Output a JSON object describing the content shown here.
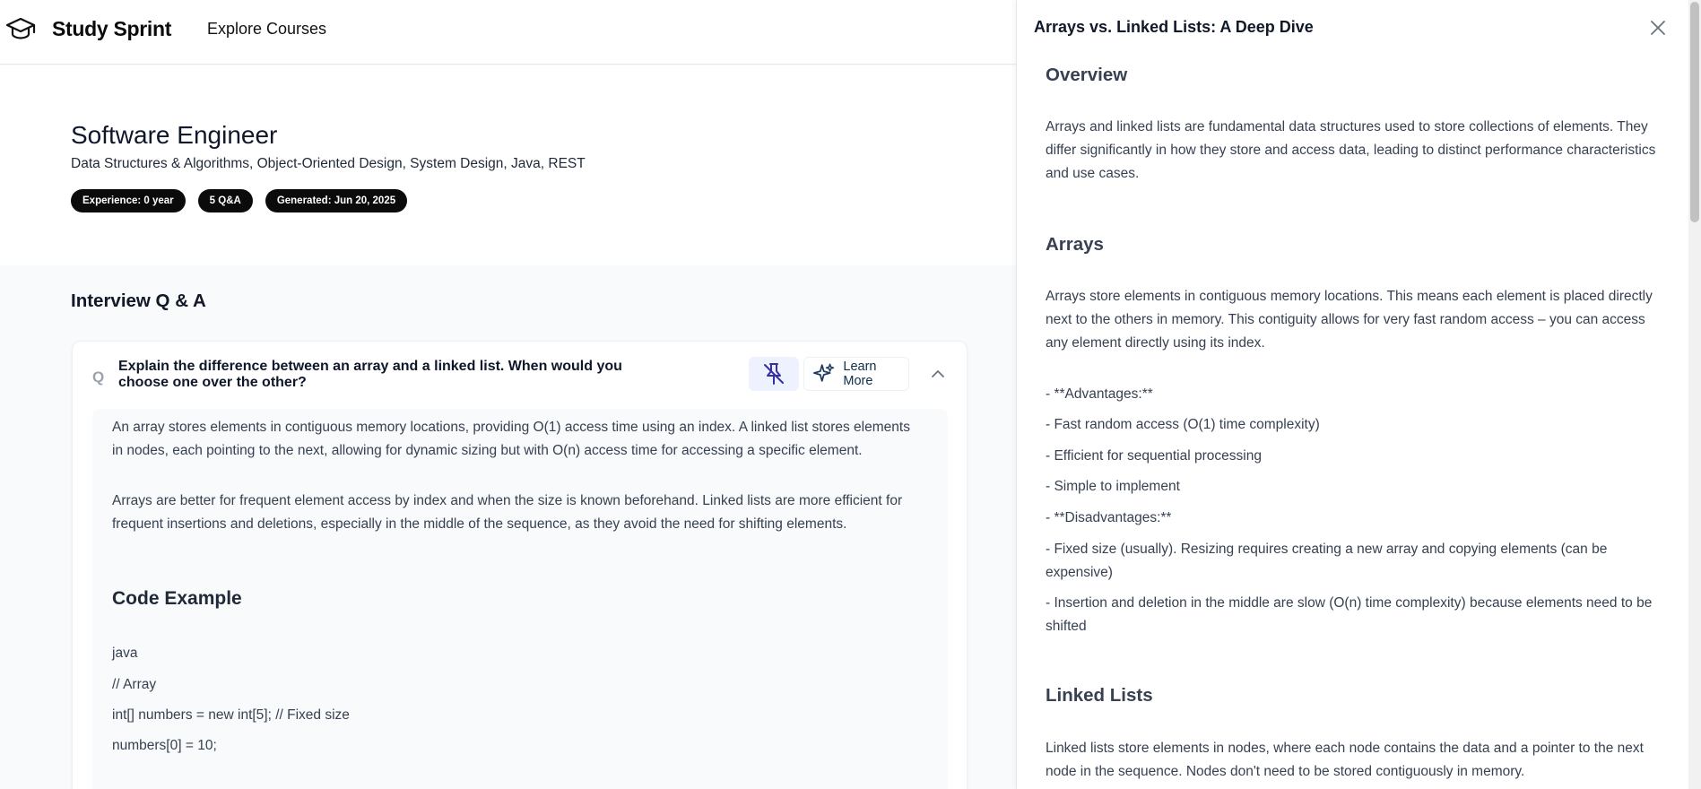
{
  "header": {
    "brand": "Study Sprint",
    "nav_link": "Explore Courses"
  },
  "role": {
    "title": "Software Engineer",
    "topics": "Data Structures & Algorithms, Object-Oriented Design, System Design, Java, REST",
    "badges": [
      "Experience: 0 year",
      "5 Q&A",
      "Generated: Jun 20, 2025"
    ]
  },
  "qa": {
    "section_title": "Interview Q & A",
    "question_mark": "Q",
    "question": "Explain the difference between an array and a linked list. When would you choose one over the other?",
    "learn_more_label": "Learn More",
    "answer_p1": "An array stores elements in contiguous memory locations, providing O(1) access time using an index. A linked list stores elements in nodes, each pointing to the next, allowing for dynamic sizing but with O(n) access time for accessing a specific element.",
    "answer_p2": "Arrays are better for frequent element access by index and when the size is known beforehand. Linked lists are more efficient for frequent insertions and deletions, especially in the middle of the sequence, as they avoid the need for shifting elements.",
    "code_heading": "Code Example",
    "code_lines": [
      "java",
      "// Array",
      "int[] numbers = new int[5]; // Fixed size",
      "numbers[0] = 10;"
    ]
  },
  "drawer": {
    "title": "Arrays vs. Linked Lists: A Deep Dive",
    "overview_heading": "Overview",
    "overview_text": "Arrays and linked lists are fundamental data structures used to store collections of elements. They differ significantly in how they store and access data, leading to distinct performance characteristics and use cases.",
    "arrays_heading": "Arrays",
    "arrays_text": "Arrays store elements in contiguous memory locations. This means each element is placed directly next to the others in memory. This contiguity allows for very fast random access – you can access any element directly using its index.",
    "arrays_points": [
      "- **Advantages:**",
      "- Fast random access (O(1) time complexity)",
      "- Efficient for sequential processing",
      "- Simple to implement",
      "- **Disadvantages:**",
      "- Fixed size (usually). Resizing requires creating a new array and copying elements (can be expensive)",
      "- Insertion and deletion in the middle are slow (O(n) time complexity) because elements need to be shifted"
    ],
    "linked_heading": "Linked Lists",
    "linked_text": "Linked lists store elements in nodes, where each node contains the data and a pointer to the next node in the sequence. Nodes don't need to be stored contiguously in memory."
  },
  "colors": {
    "badge_bg": "#0b0b0b",
    "pin_bg": "#eef2ff",
    "accent_icon": "#1e3a5f",
    "pin_icon": "#3730a3"
  },
  "icons": {
    "logo": "graduation-cap-icon",
    "pin": "pin-off-icon",
    "learn_more": "sparkles-icon",
    "collapse": "chevron-up-icon",
    "close": "close-icon"
  }
}
